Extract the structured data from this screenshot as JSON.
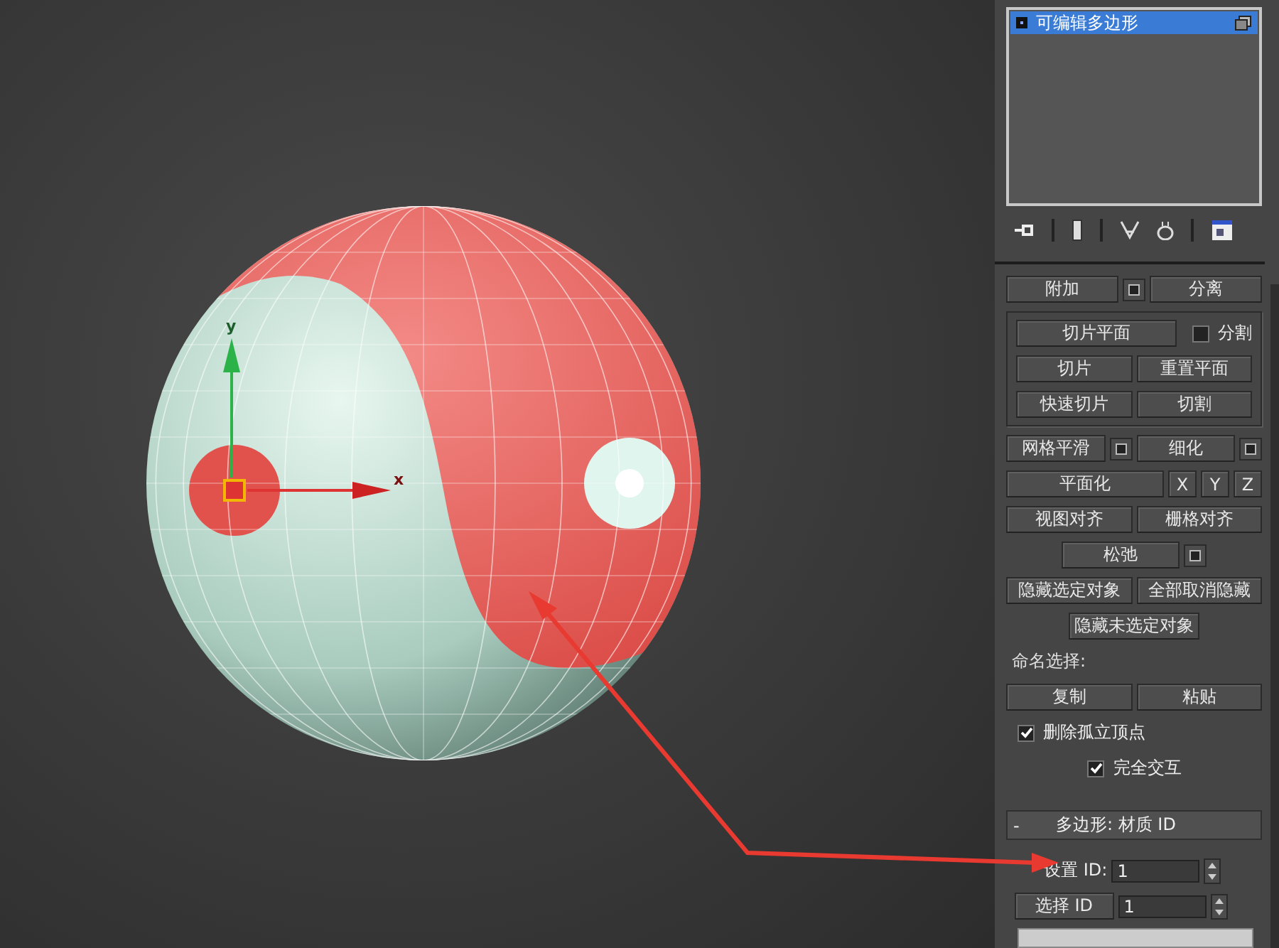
{
  "viewport": {
    "gizmo": {
      "y_label": "y",
      "x_label": "x"
    }
  },
  "modifier_stack": {
    "items": [
      {
        "label": "可编辑多边形",
        "selected": true
      }
    ]
  },
  "edit_geometry": {
    "rows": [
      [
        {
          "kind": "button",
          "label": "附加"
        },
        {
          "kind": "settings"
        },
        {
          "kind": "button",
          "label": "分离"
        }
      ]
    ],
    "slice_group": [
      [
        {
          "kind": "button",
          "label": "切片平面"
        },
        {
          "kind": "checkbox",
          "label": "分割",
          "checked": false
        }
      ],
      [
        {
          "kind": "button",
          "label": "切片"
        },
        {
          "kind": "button",
          "label": "重置平面"
        }
      ],
      [
        {
          "kind": "button",
          "label": "快速切片"
        },
        {
          "kind": "button",
          "label": "切割"
        }
      ]
    ],
    "rows_after": [
      [
        {
          "kind": "button",
          "label": "网格平滑"
        },
        {
          "kind": "settings"
        },
        {
          "kind": "button",
          "label": "细化"
        },
        {
          "kind": "settings"
        }
      ],
      [
        {
          "kind": "button",
          "label": "平面化"
        },
        {
          "kind": "small",
          "label": "X"
        },
        {
          "kind": "small",
          "label": "Y"
        },
        {
          "kind": "small",
          "label": "Z"
        }
      ],
      [
        {
          "kind": "button",
          "label": "视图对齐"
        },
        {
          "kind": "button",
          "label": "栅格对齐"
        }
      ],
      [
        {
          "kind": "spacer"
        },
        {
          "kind": "button",
          "label": "松弛"
        },
        {
          "kind": "settings"
        },
        {
          "kind": "spacer"
        }
      ],
      [
        {
          "kind": "button",
          "label": "隐藏选定对象"
        },
        {
          "kind": "button",
          "label": "全部取消隐藏"
        }
      ],
      [
        {
          "kind": "spacer"
        },
        {
          "kind": "button",
          "label": "隐藏未选定对象"
        },
        {
          "kind": "spacer"
        }
      ],
      [
        {
          "kind": "label",
          "label": "命名选择:"
        }
      ],
      [
        {
          "kind": "button",
          "label": "复制"
        },
        {
          "kind": "button",
          "label": "粘贴"
        }
      ],
      [
        {
          "kind": "checkbox",
          "label": "删除孤立顶点",
          "checked": true
        }
      ],
      [
        {
          "kind": "spacer"
        },
        {
          "kind": "checkbox",
          "label": "完全交互",
          "checked": true
        }
      ]
    ]
  },
  "material_id": {
    "collapse_symbol": "-",
    "title": "多边形: 材质 ID",
    "set_id": {
      "label": "设置 ID:",
      "value": "1"
    },
    "select_id": {
      "label": "选择 ID",
      "value": "1"
    }
  }
}
